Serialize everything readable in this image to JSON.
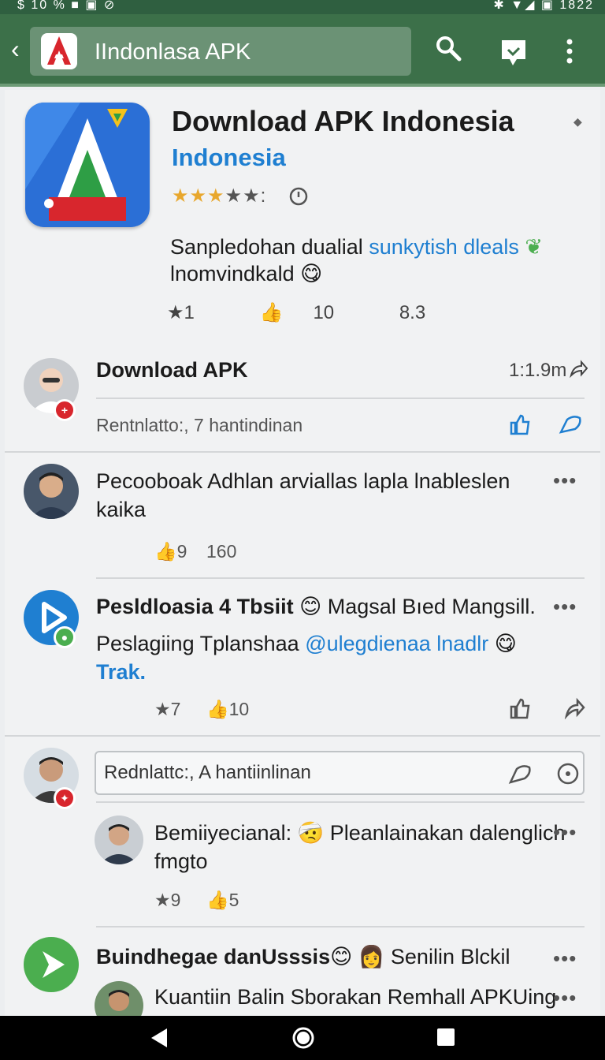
{
  "status_bar": {
    "left": "$ 10  % ■ ▣ ⊘",
    "right": "✱ ▼◢ ▣ 1822"
  },
  "app_bar": {
    "title": "IIndonlasa APK"
  },
  "hero": {
    "title": "Download APK Indonesia",
    "subtitle": "Indonesia",
    "rating_stars": 3.5,
    "desc_line1": "Sanpledohan dualial ",
    "desc_line1_link": "sunkytish dleals",
    "desc_line2": "lnomvindkald",
    "stat_stars": "1",
    "stat_likes": "10",
    "stat_score": "8.3"
  },
  "post1": {
    "title": "Download APK",
    "time": "1:1.9m",
    "meta": "Rentnlatto:, 7 hantindinan"
  },
  "post2": {
    "text": "Pecooboak Adhlan arviallas lapla lnableslen kaika",
    "likes_icon": "9",
    "count": "160"
  },
  "post3": {
    "title": "Pesldloasia 4 Tbsiit",
    "title_rest": "Magsal Bıed Mangsill.",
    "text": "Peslagiing Tplanshaa ",
    "text_link": "@ulegdienaa lnadlr",
    "link_tail": "Trak.",
    "stars": "7",
    "likes": "10"
  },
  "comment": {
    "placeholder": "Rednlattc:, A hantiinlinan"
  },
  "reply1": {
    "title": "Bemiiyecianal:",
    "title_rest": "Pleanlainakan dalenglich",
    "line2": "fmgto",
    "stars": "9",
    "likes": "5"
  },
  "post4": {
    "title": "Buindhegae danUsssis",
    "title_rest": "Senilin Blckil",
    "reply_text": "Kuantiin Balin Sborakan Remhall APKUing"
  },
  "colors": {
    "appbar": "#3c7049",
    "accent": "#1f7fd1",
    "star": "#e8a72d"
  }
}
